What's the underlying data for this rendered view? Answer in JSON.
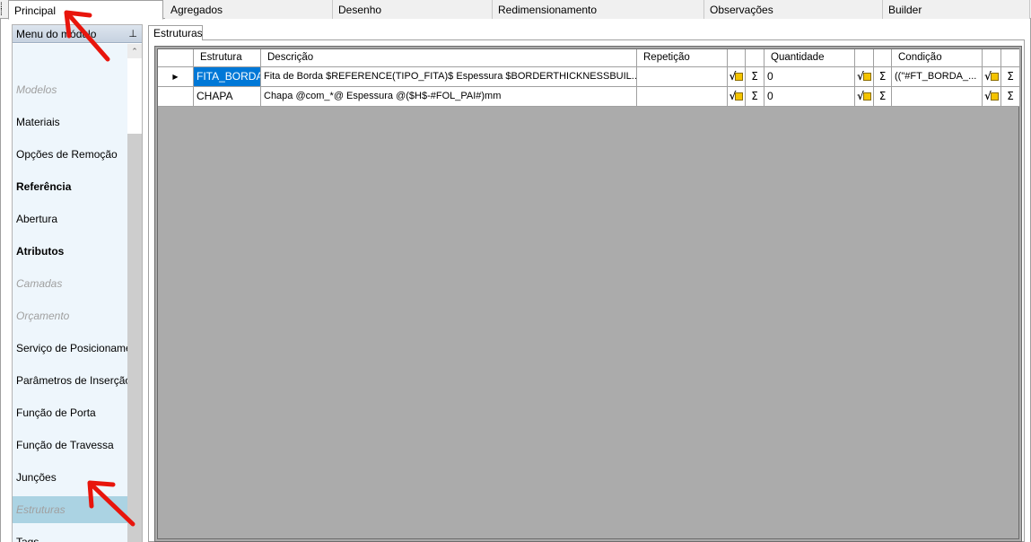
{
  "top_tabs": [
    {
      "label": "Principal",
      "active": true
    },
    {
      "label": "Agregados",
      "active": false
    },
    {
      "label": "Desenho",
      "active": false
    },
    {
      "label": "Redimensionamento",
      "active": false
    },
    {
      "label": "Observações",
      "active": false
    },
    {
      "label": "Builder",
      "active": false
    }
  ],
  "menu": {
    "title": "Menu do módulo",
    "items": [
      {
        "label": "Modelos",
        "style": "disabled"
      },
      {
        "label": "Materiais",
        "style": "normal"
      },
      {
        "label": "Opções de Remoção",
        "style": "normal"
      },
      {
        "label": "Referência",
        "style": "bold"
      },
      {
        "label": "Abertura",
        "style": "normal"
      },
      {
        "label": "Atributos",
        "style": "bold"
      },
      {
        "label": "Camadas",
        "style": "disabled"
      },
      {
        "label": "Orçamento",
        "style": "disabled"
      },
      {
        "label": "Serviço de Posicionamento",
        "style": "normal"
      },
      {
        "label": "Parâmetros de Inserção",
        "style": "normal"
      },
      {
        "label": "Função de Porta",
        "style": "normal"
      },
      {
        "label": "Função de Travessa",
        "style": "normal"
      },
      {
        "label": "Junções",
        "style": "normal"
      },
      {
        "label": "Estruturas",
        "style": "disabled",
        "selected": true
      },
      {
        "label": "Tags",
        "style": "normal"
      }
    ]
  },
  "inner_tab": "Estruturas",
  "grid": {
    "headers": {
      "estrutura": "Estrutura",
      "descricao": "Descrição",
      "repeticao": "Repetição",
      "quantidade": "Quantidade",
      "condicao": "Condição"
    },
    "rows": [
      {
        "estrutura": "FITA_BORDA",
        "descricao": "Fita de Borda $REFERENCE(TIPO_FITA)$ Espessura $BORDERTHICKNESSBUIL...",
        "repeticao": "",
        "quantidade": "0",
        "condicao": "((\"#FT_BORDA_...",
        "current": true
      },
      {
        "estrutura": "CHAPA",
        "descricao": "Chapa @com_*@ Espessura @($H$-#FOL_PAI#)mm",
        "repeticao": "",
        "quantidade": "0",
        "condicao": "",
        "current": false
      }
    ]
  },
  "icons": {
    "sqrt": "√",
    "sigma": "Σ",
    "pin": "ᵖ",
    "row_pointer": "▶",
    "scroll_up": "^"
  },
  "colors": {
    "selected_menu": "#abd3e3",
    "menu_bg": "#eef6fc",
    "selected_cell": "#0078d7",
    "grid_bg": "#ababab",
    "annotation": "#e8150c"
  }
}
